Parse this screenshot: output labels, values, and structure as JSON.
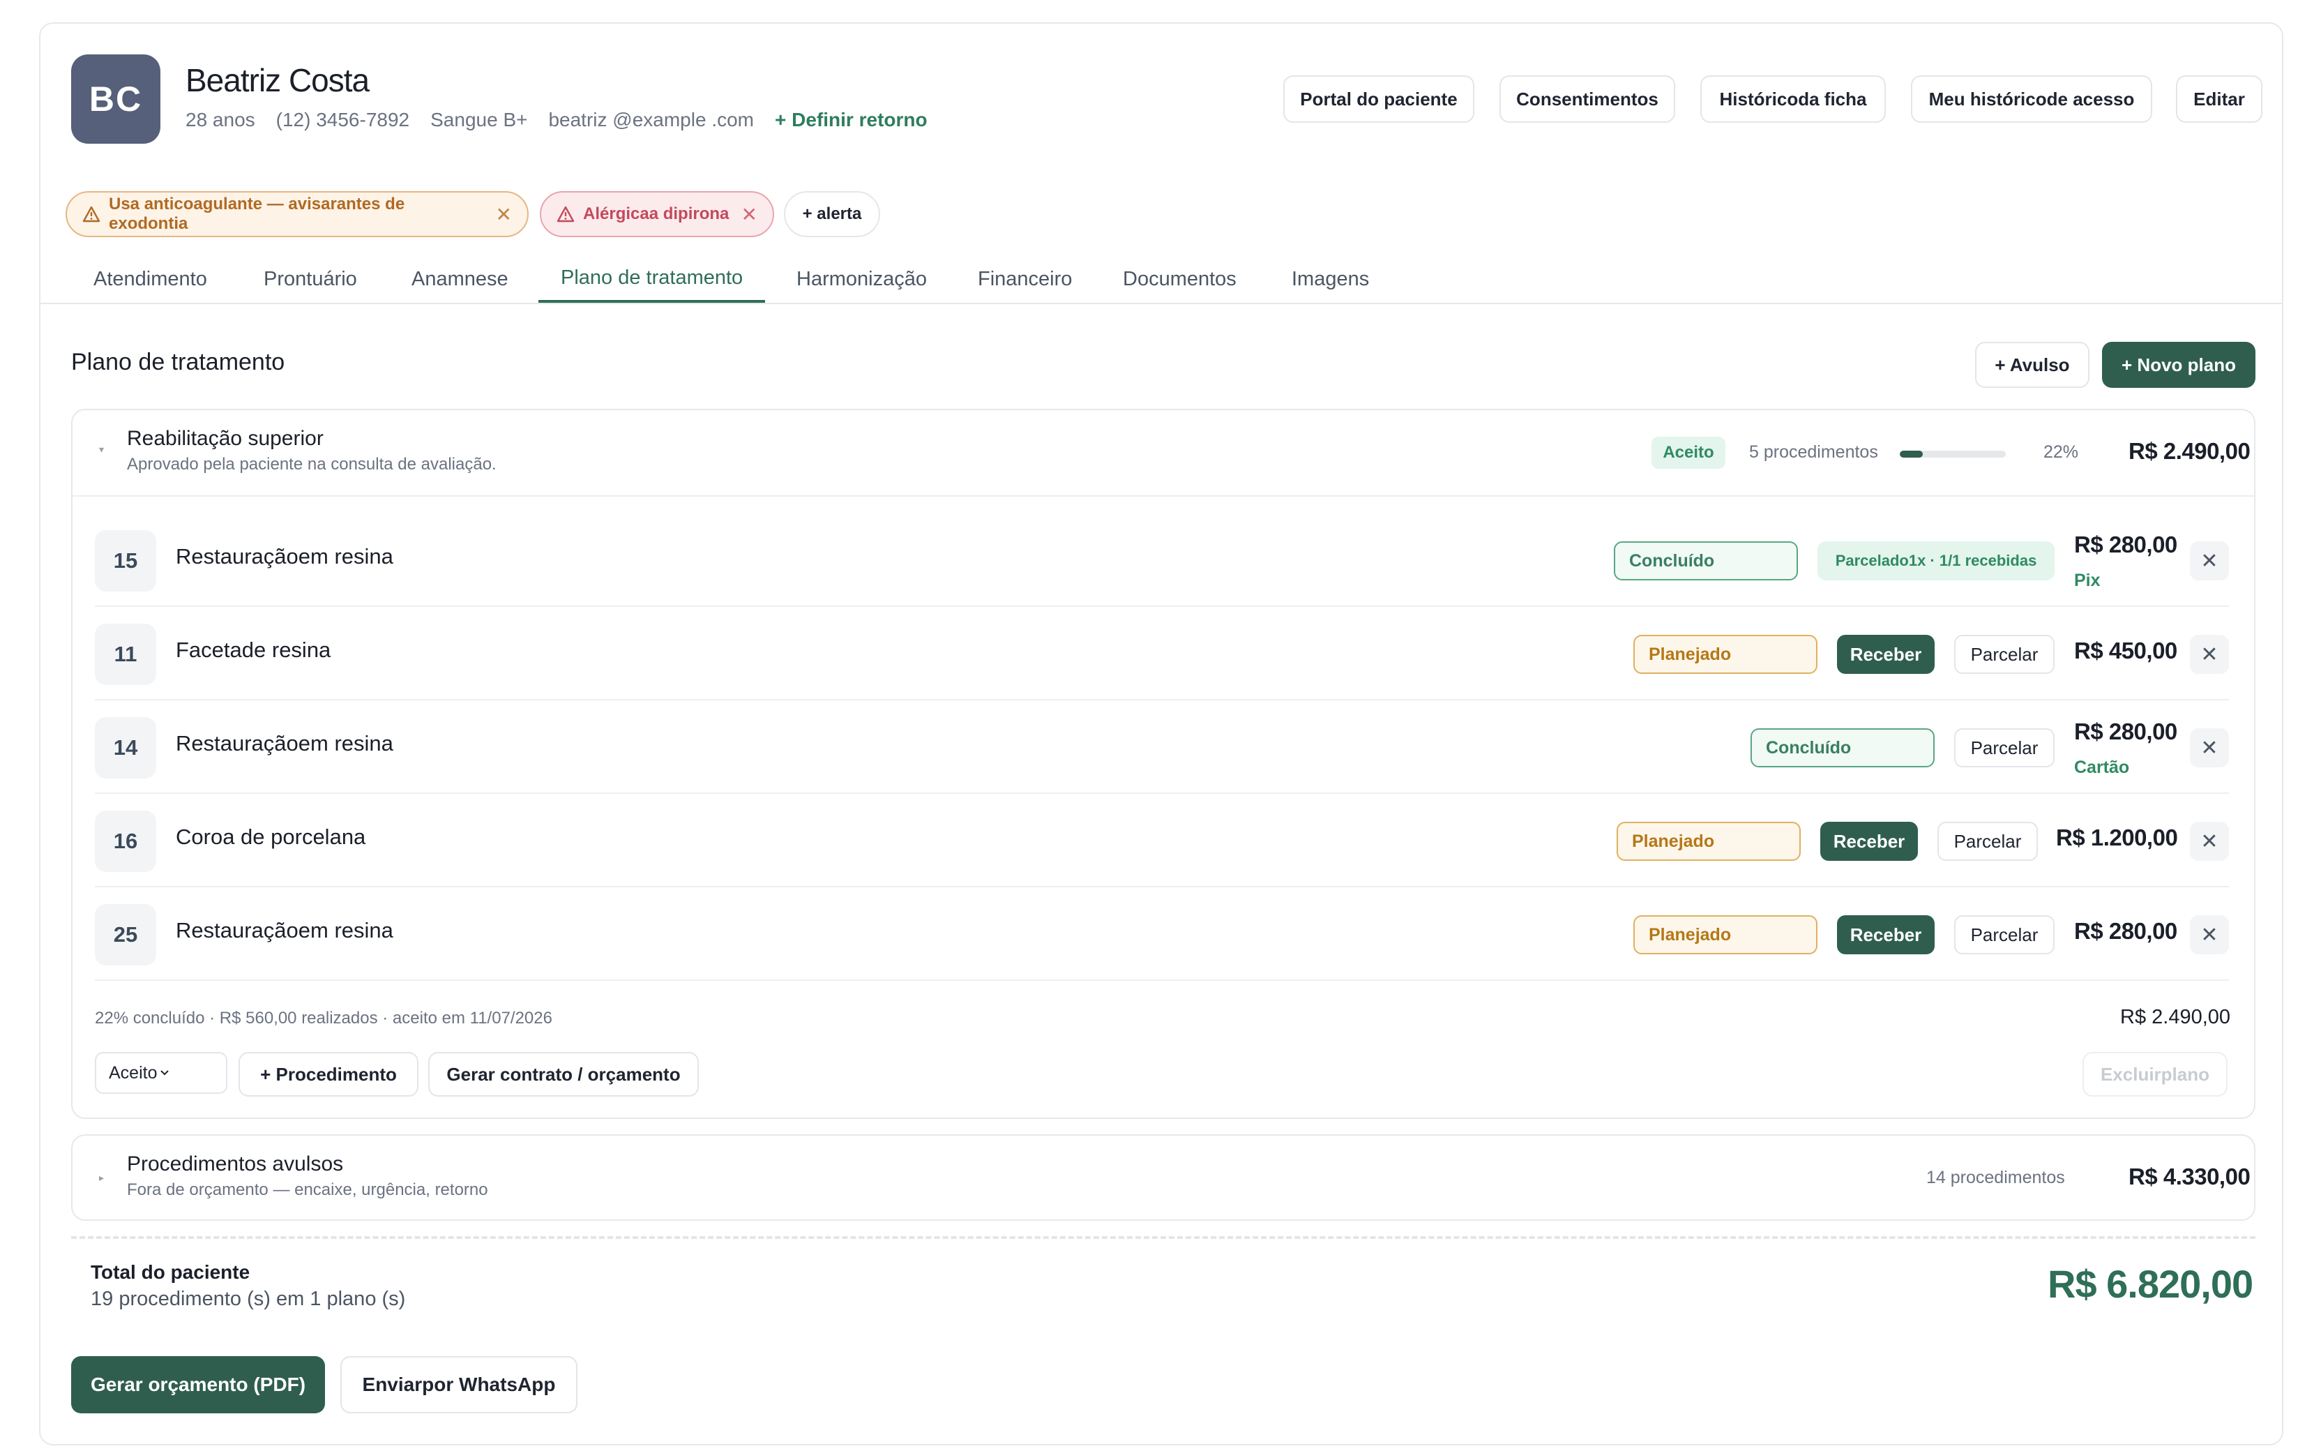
{
  "patient": {
    "initials": "BC",
    "name": "Beatriz Costa",
    "age": "28 anos",
    "phone": "(12) 3456-7892",
    "blood": "Sangue B+",
    "email": "beatriz @example .com",
    "set_return": "+ Definir retorno"
  },
  "header_buttons": {
    "portal": "Portal do paciente",
    "consents": "Consentimentos",
    "history": "Históricoda ficha",
    "access": "Meu históricode acesso",
    "edit": "Editar"
  },
  "alerts": {
    "anticoag": "Usa anticoagulante — avisarantes de exodontia",
    "allergy": "Alérgicaa dipirona",
    "add": "+ alerta",
    "close": "✕"
  },
  "tabs": [
    "Atendimento",
    "Prontuário",
    "Anamnese",
    "Plano de tratamento",
    "Harmonização",
    "Financeiro",
    "Documentos",
    "Imagens"
  ],
  "active_tab": "Plano de tratamento",
  "section": {
    "title": "Plano de tratamento",
    "avulso_button": "+ Avulso",
    "new_plan_button": "+ Novo plano"
  },
  "plan": {
    "title": "Reabilitação superior",
    "description": "Aprovado pela paciente na consulta de avaliação.",
    "status": "Aceito",
    "count": "5 procedimentos",
    "progress_percent": 22,
    "progress_label": "22%",
    "total": "R$ 2.490,00",
    "rows": [
      {
        "tooth": "15",
        "name": "Restauraçãoem resina",
        "status": "Concluído",
        "installments": "Parcelado1x · 1/1 recebidas",
        "price": "R$ 280,00",
        "payment": "Pix"
      },
      {
        "tooth": "11",
        "name": "Facetade resina",
        "status": "Planejado",
        "receive": "Receber",
        "split": "Parcelar",
        "price": "R$ 450,00"
      },
      {
        "tooth": "14",
        "name": "Restauraçãoem resina",
        "status": "Concluído",
        "split": "Parcelar",
        "price": "R$ 280,00",
        "payment": "Cartão"
      },
      {
        "tooth": "16",
        "name": "Coroa de porcelana",
        "status": "Planejado",
        "receive": "Receber",
        "split": "Parcelar",
        "price": "R$ 1.200,00"
      },
      {
        "tooth": "25",
        "name": "Restauraçãoem resina",
        "status": "Planejado",
        "receive": "Receber",
        "split": "Parcelar",
        "price": "R$ 280,00"
      }
    ],
    "summary": "22% concluído · R$ 560,00 realizados · aceito em 11/07/2026",
    "footer_total": "R$ 2.490,00",
    "status_select": "Aceito",
    "add_procedure": "+ Procedimento",
    "contract": "Gerar contrato / orçamento",
    "delete": "Excluirplano",
    "remove_symbol": "✕"
  },
  "avulsos": {
    "title": "Procedimentos avulsos",
    "description": "Fora de orçamento — encaixe, urgência, retorno",
    "count": "14 procedimentos",
    "total": "R$ 4.330,00"
  },
  "totals": {
    "label": "Total do paciente",
    "sub": "19 procedimento (s) em 1 plano (s)",
    "value": "R$ 6.820,00"
  },
  "actions": {
    "pdf": "Gerar orçamento (PDF)",
    "whatsapp": "Enviarpor WhatsApp"
  },
  "colors": {
    "brand": "#2f5e4e",
    "accent_text": "#2f6e57",
    "done": "#3a7f62",
    "planned": "#b57816",
    "warn": "#b06a24",
    "allergy": "#c34a5a"
  },
  "icons": {
    "warning": "warning-triangle-icon",
    "close": "close-icon",
    "caret": "caret-down-icon",
    "chevron": "chevron-down-icon"
  }
}
